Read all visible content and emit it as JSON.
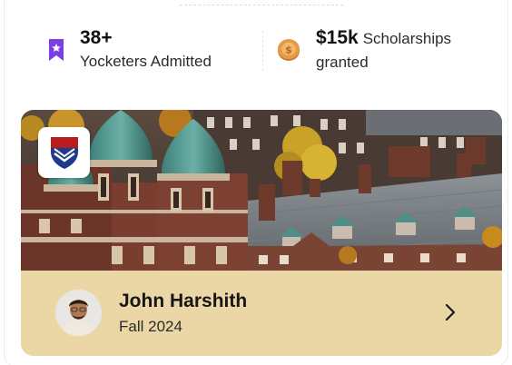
{
  "stats": {
    "admitted": {
      "value": "38+",
      "label": "Yocketers Admitted",
      "icon": "bookmark-star-icon"
    },
    "scholarships": {
      "value": "$15k",
      "label_inline": "Scholarships",
      "label_line2": "granted",
      "icon": "coin-icon"
    }
  },
  "university_card": {
    "image": "campus-photo",
    "logo": "university-shield-logo",
    "student": {
      "name": "John Harshith",
      "intake": "Fall 2024",
      "avatar": "student-avatar"
    },
    "action_icon": "chevron-right-icon"
  },
  "colors": {
    "footer_bg": "#ebd6a5",
    "bookmark_purple": "#7b3fe4",
    "coin_orange": "#e59b45",
    "shield_blue": "#1e3a8a",
    "shield_red": "#b91c1c"
  }
}
